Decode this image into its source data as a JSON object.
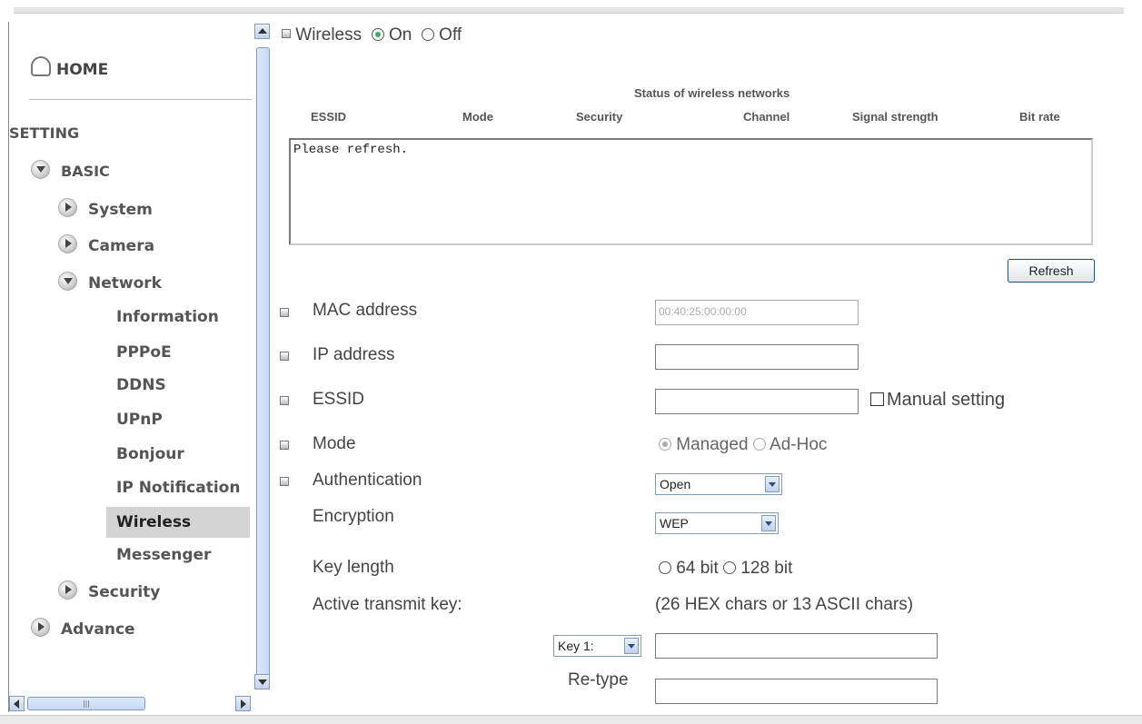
{
  "sidebar": {
    "home": "HOME",
    "setting": "SETTING",
    "basic": "BASIC",
    "system": "System",
    "camera": "Camera",
    "network": "Network",
    "network_items": [
      "Information",
      "PPPoE",
      "DDNS",
      "UPnP",
      "Bonjour",
      "IP Notification",
      "Wireless",
      "Messenger"
    ],
    "security": "Security",
    "advance": "Advance",
    "selected": "Wireless"
  },
  "wireless": {
    "title": "Wireless",
    "on_label": "On",
    "off_label": "Off",
    "state": "On"
  },
  "networks": {
    "caption": "Status of wireless networks",
    "columns": [
      "ESSID",
      "Mode",
      "Security",
      "Channel",
      "Signal strength",
      "Bit rate"
    ],
    "list_text": "Please refresh.",
    "refresh_label": "Refresh"
  },
  "form": {
    "mac_label": "MAC address",
    "mac_value": "00:40:25:00:00:00",
    "ip_label": "IP address",
    "ip_value": "",
    "essid_label": "ESSID",
    "essid_value": "",
    "manual_label": "Manual setting",
    "mode_label": "Mode",
    "mode_managed": "Managed",
    "mode_adhoc": "Ad-Hoc",
    "auth_label": "Authentication",
    "auth_value": "Open",
    "enc_label": "Encryption",
    "enc_value": "WEP",
    "keylen_label": "Key length",
    "key64": "64 bit",
    "key128": "128 bit",
    "active_key_label": "Active transmit key:",
    "key_hint": "(26 HEX chars or 13 ASCII chars)",
    "key_select": "Key 1:",
    "retype_label": "Re-type"
  },
  "icons": {
    "home": "home-icon",
    "expand": "chevron-down-icon",
    "collapse": "chevron-right-icon",
    "bullet": "square-bullet-icon"
  }
}
